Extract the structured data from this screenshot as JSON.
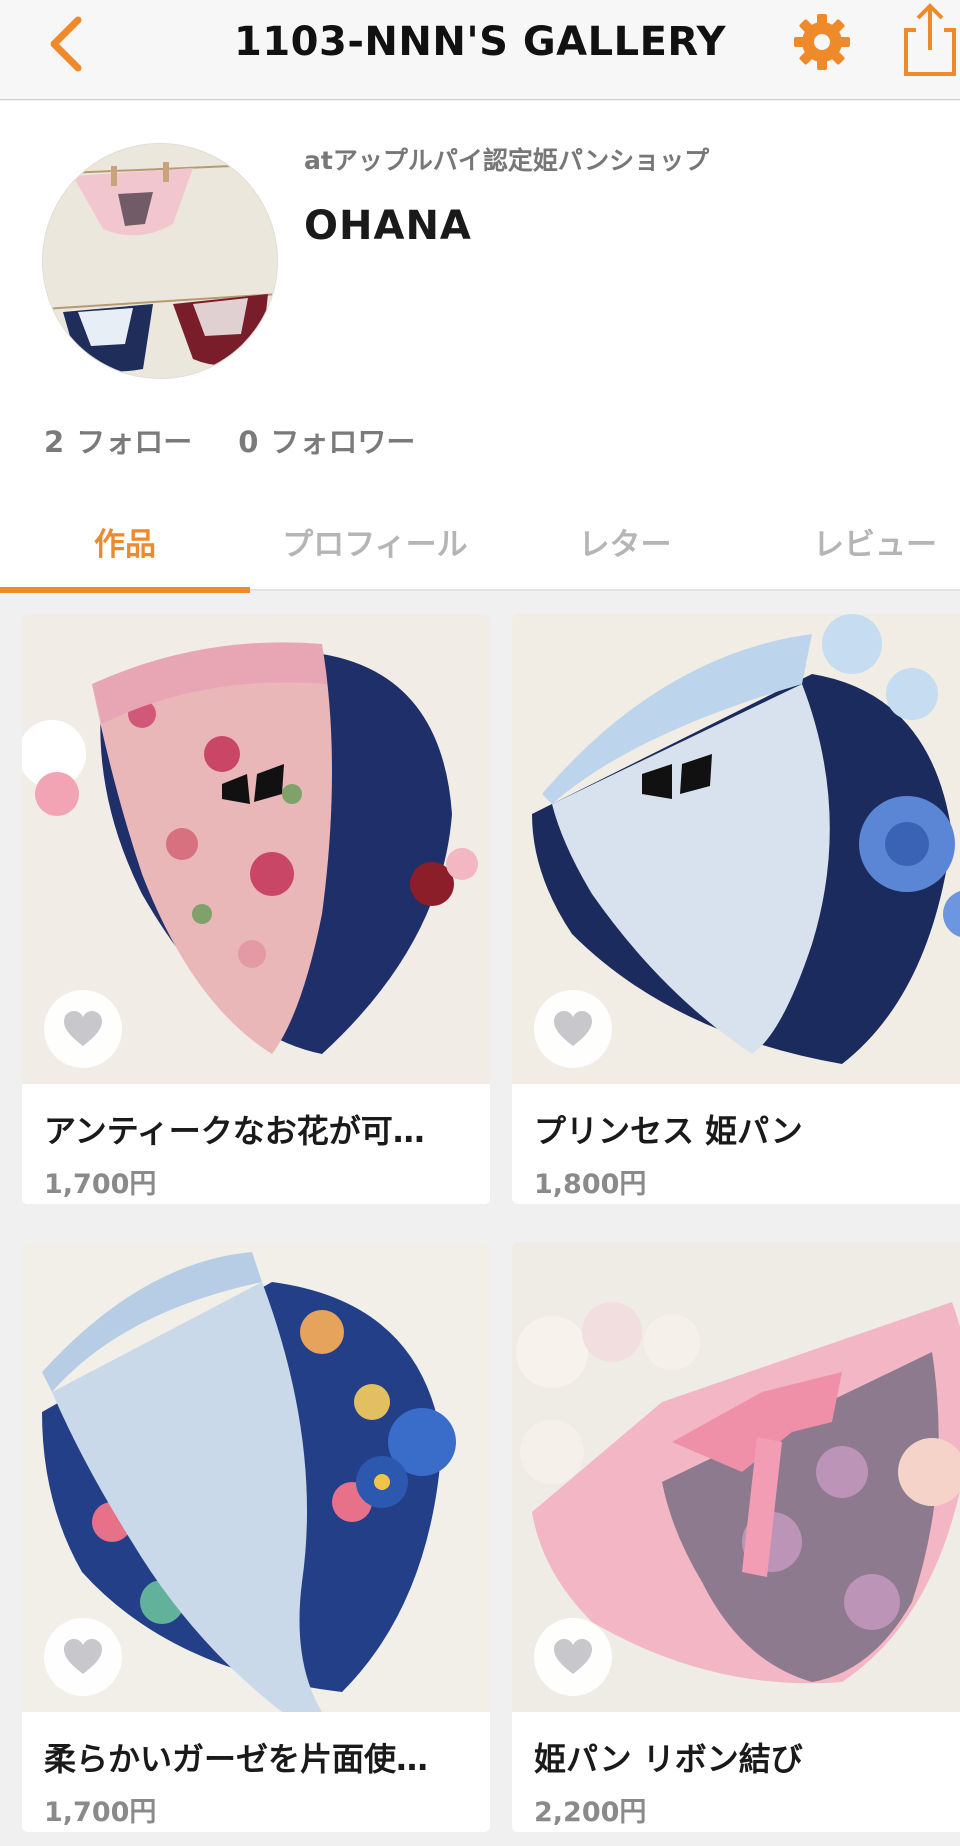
{
  "nav": {
    "title": "1103-NNN'S GALLERY",
    "back_icon": "chevron-left-icon",
    "settings_icon": "gear-icon",
    "share_icon": "share-icon"
  },
  "colors": {
    "accent": "#ef8a2a",
    "muted": "#8a8a8a",
    "tab_inactive": "#b5b5b5"
  },
  "profile": {
    "subtitle": "atアップルパイ認定姫パンショップ",
    "name": "OHANA",
    "follow_count": "2",
    "follow_label": "フォロー",
    "follower_count": "0",
    "follower_label": "フォロワー"
  },
  "tabs": [
    {
      "label": "作品",
      "active": true
    },
    {
      "label": "プロフィール",
      "active": false
    },
    {
      "label": "レター",
      "active": false
    },
    {
      "label": "レビュー",
      "active": false
    }
  ],
  "items": [
    {
      "title": "アンティークなお花が可…",
      "price": "1,700円"
    },
    {
      "title": "プリンセス 姫パン",
      "price": "1,800円"
    },
    {
      "title": "柔らかいガーゼを片面使…",
      "price": "1,700円"
    },
    {
      "title": "姫パン リボン結び",
      "price": "2,200円"
    }
  ]
}
